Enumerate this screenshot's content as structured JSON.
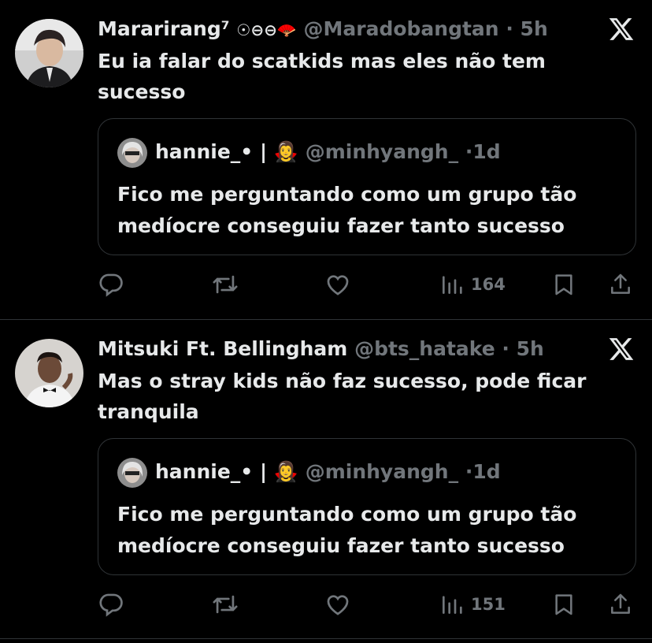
{
  "tweets": [
    {
      "display_name": "Mararirang⁷",
      "badge": "☉⊖⊖🪭",
      "handle": "@Maradobangtan",
      "dot": "·",
      "time": "5h",
      "text": "Eu ia falar do scatkids mas eles não tem sucesso",
      "quote": {
        "display_name": "hannie_•",
        "separator": "|",
        "emoji": "🧛‍♀️",
        "handle": "@minhyangh_",
        "dot": "·",
        "time": "1d",
        "text": "Fico me perguntando como um grupo tão medíocre conseguiu fazer tanto sucesso"
      },
      "views": "164"
    },
    {
      "display_name": "Mitsuki Ft. Bellingham",
      "badge": "",
      "handle": "@bts_hatake",
      "dot": "·",
      "time": "5h",
      "text": "Mas o stray kids não faz sucesso, pode ficar tranquila",
      "quote": {
        "display_name": "hannie_•",
        "separator": "|",
        "emoji": "🧛‍♀️",
        "handle": "@minhyangh_",
        "dot": "·",
        "time": "1d",
        "text": "Fico me perguntando como um grupo tão medíocre conseguiu fazer tanto sucesso"
      },
      "views": "151"
    }
  ],
  "colors": {
    "background": "#000000",
    "text": "#e7e9ea",
    "muted": "#71767b",
    "border": "#2f3336"
  },
  "icons": [
    "x-logo-icon",
    "reply-icon",
    "retweet-icon",
    "like-icon",
    "views-icon",
    "bookmark-icon",
    "share-icon"
  ]
}
